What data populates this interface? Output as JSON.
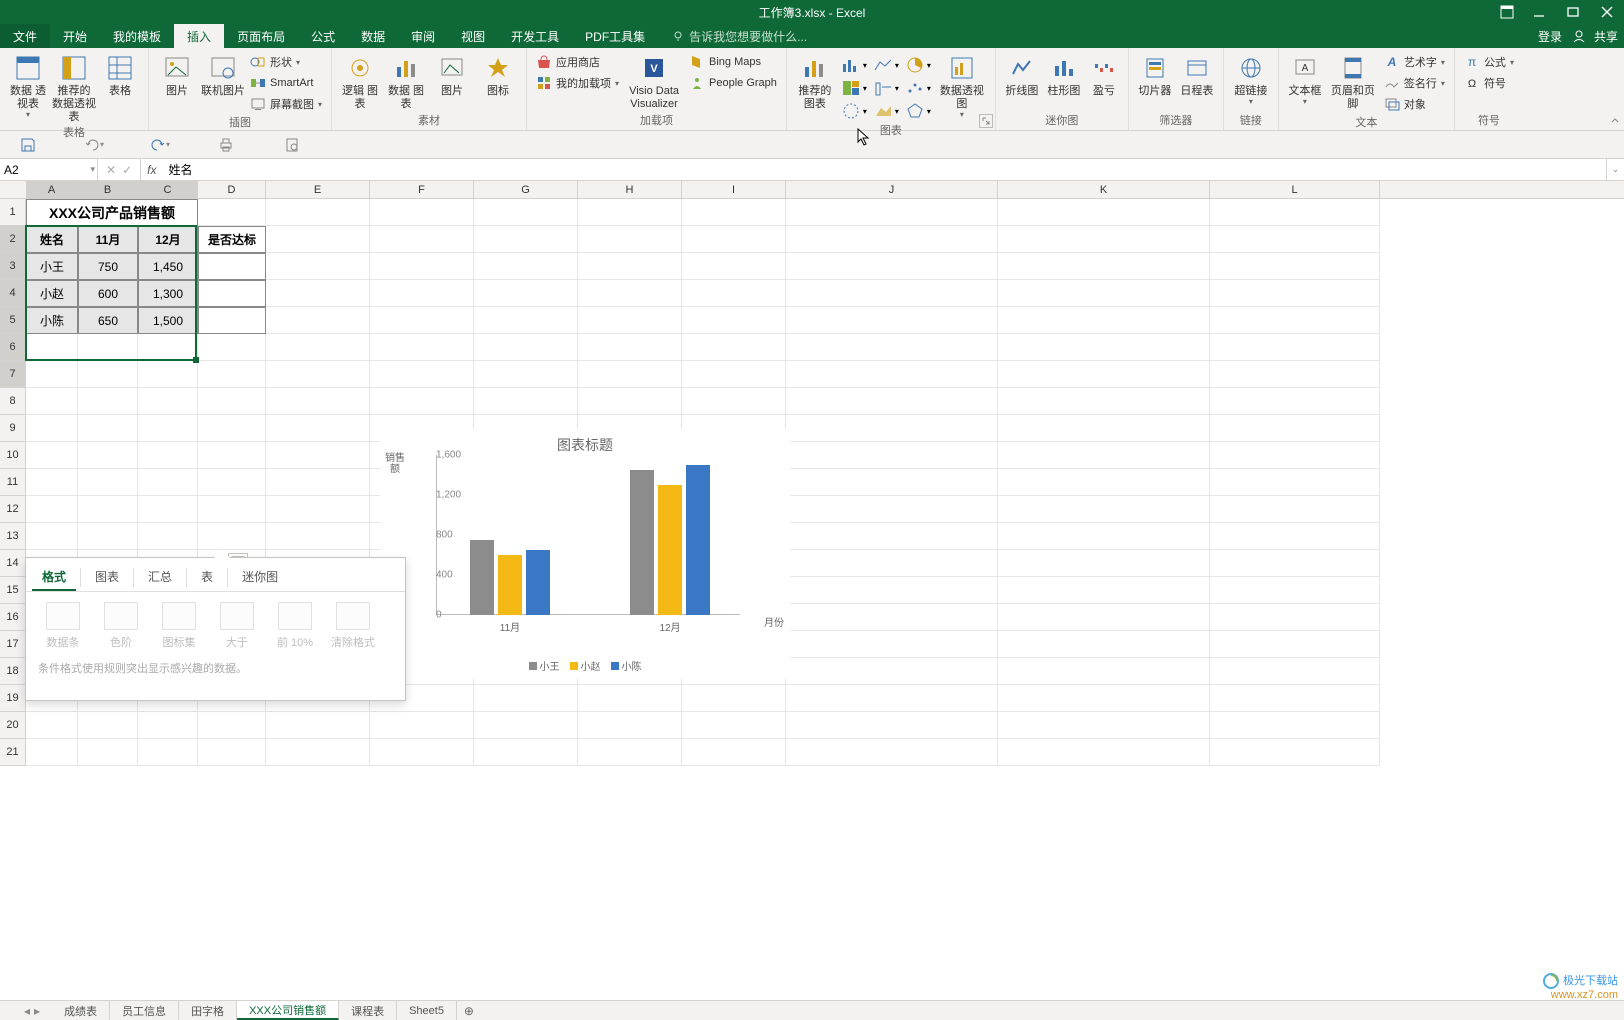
{
  "titlebar": {
    "title": "工作簿3.xlsx - Excel"
  },
  "menutabs": {
    "file": "文件",
    "tabs": [
      "开始",
      "我的模板",
      "插入",
      "页面布局",
      "公式",
      "数据",
      "审阅",
      "视图",
      "开发工具",
      "PDF工具集"
    ],
    "active": "插入",
    "tellme": "告诉我您想要做什么...",
    "login": "登录",
    "share": "共享"
  },
  "ribbon": {
    "tables": {
      "label": "表格",
      "pivot": "数据\n透视表",
      "rec_pivot": "推荐的\n数据透视表",
      "table": "表格"
    },
    "illus": {
      "label": "插图",
      "pic": "图片",
      "online": "联机图片",
      "shapes": "形状",
      "smartart": "SmartArt",
      "screenshot": "屏幕截图"
    },
    "assets": {
      "label": "素材",
      "editpic": "逻辑\n图表",
      "editdata": "数据\n图表",
      "editimg": "图片",
      "editicon": "图标"
    },
    "addins": {
      "label": "加载项",
      "store": "应用商店",
      "myaddins": "我的加载项",
      "visio": "Visio Data\nVisualizer",
      "bing": "Bing Maps",
      "people": "People Graph"
    },
    "charts": {
      "label": "图表",
      "rec": "推荐的\n图表",
      "pivotchart": "数据透视图"
    },
    "spark": {
      "label": "迷你图",
      "line": "折线图",
      "col": "柱形图",
      "winloss": "盈亏"
    },
    "filter": {
      "label": "筛选器",
      "slicer": "切片器",
      "timeline": "日程表"
    },
    "links": {
      "label": "链接",
      "hyper": "超链接"
    },
    "text": {
      "label": "文本",
      "textbox": "文本框",
      "header": "页眉和页脚",
      "wordart": "艺术字",
      "sig": "签名行",
      "obj": "对象"
    },
    "symbols": {
      "label": "符号",
      "eq": "公式",
      "sym": "符号"
    }
  },
  "fbar": {
    "name": "A2",
    "cancel": "✕",
    "enter": "✓",
    "fx": "fx",
    "value": "姓名"
  },
  "columns": [
    "A",
    "B",
    "C",
    "D",
    "E",
    "F",
    "G",
    "H",
    "I",
    "J",
    "K",
    "L"
  ],
  "table": {
    "title": "XXX公司产品销售额",
    "headers": [
      "姓名",
      "11月",
      "12月",
      "是否达标"
    ],
    "rows": [
      {
        "name": "小王",
        "nov": "750",
        "dec": "1,450",
        "ok": ""
      },
      {
        "name": "小赵",
        "nov": "600",
        "dec": "1,300",
        "ok": ""
      },
      {
        "name": "小陈",
        "nov": "650",
        "dec": "1,500",
        "ok": ""
      }
    ]
  },
  "quick": {
    "tabs": [
      "格式",
      "图表",
      "汇总",
      "表",
      "迷你图"
    ],
    "active": "格式",
    "opts": [
      "数据条",
      "色阶",
      "图标集",
      "大于",
      "前 10%",
      "清除格式"
    ],
    "hint": "条件格式使用规则突出显示感兴趣的数据。"
  },
  "chart_data": {
    "type": "bar",
    "title": "图表标题",
    "ylabel": "销售额",
    "xlabel": "月份",
    "categories": [
      "11月",
      "12月"
    ],
    "series": [
      {
        "name": "小王",
        "values": [
          750,
          1450
        ],
        "color": "#8c8c8c"
      },
      {
        "name": "小赵",
        "values": [
          600,
          1300
        ],
        "color": "#f5b916"
      },
      {
        "name": "小陈",
        "values": [
          650,
          1500
        ],
        "color": "#3a77c5"
      }
    ],
    "yticks": [
      0,
      400,
      800,
      1200,
      1600
    ],
    "ylim": [
      0,
      1600
    ]
  },
  "sheets": {
    "tabs": [
      "成绩表",
      "员工信息",
      "田字格",
      "XXX公司销售额",
      "课程表",
      "Sheet5"
    ],
    "active": "XXX公司销售额"
  },
  "watermark": {
    "name": "极光下载站",
    "url": "www.xz7.com"
  }
}
